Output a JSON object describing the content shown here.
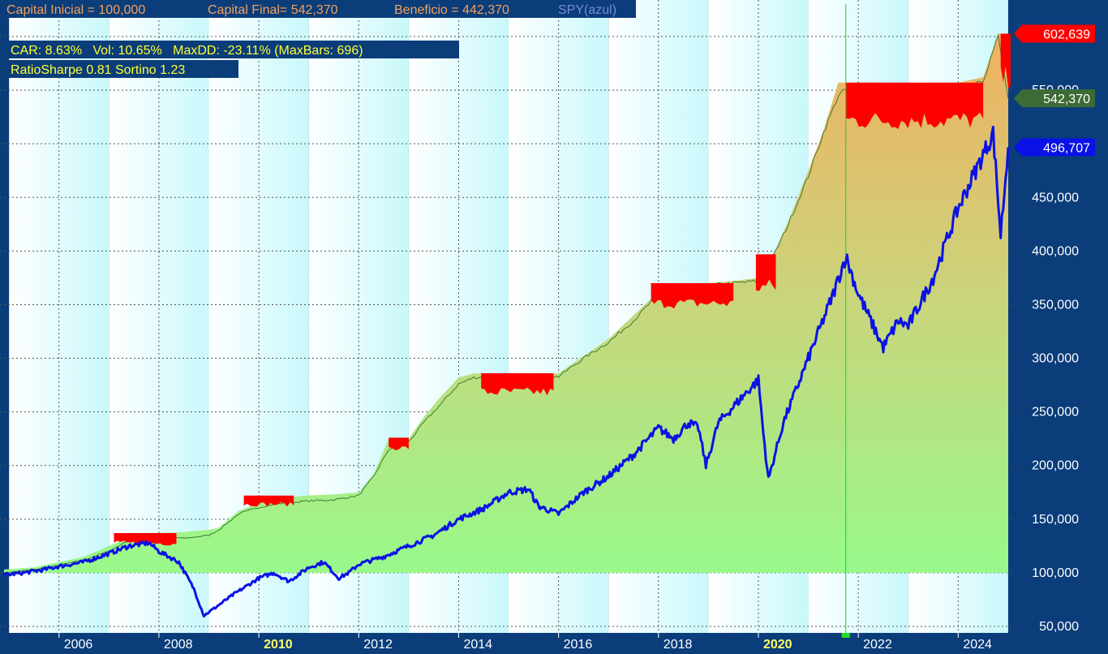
{
  "header": {
    "capital_inicial": "Capital Inicial = 100,000",
    "capital_final": "Capital Final= 542,370",
    "beneficio": "Beneficio = 442,370",
    "spy_label": "SPY(azul)"
  },
  "stats": {
    "line1": "CAR: 8.63%   Vol: 10.65%   MaxDD: -23.11% (MaxBars: 696)",
    "line2": "RatioSharpe 0.81 Sortino 1.23"
  },
  "colors": {
    "background": "#0a3d7a",
    "equity_fill_low": "#98f98a",
    "equity_fill_high": "#f0b060",
    "drawdown": "#ff0000",
    "spy_line": "#0a12e6",
    "marker_line": "#22cc22"
  },
  "chart_data": {
    "type": "area",
    "y_axis": {
      "min": 50000,
      "max": 600000,
      "ticks": [
        "50,000",
        "100,000",
        "150,000",
        "200,000",
        "250,000",
        "300,000",
        "350,000",
        "400,000",
        "450,000",
        "500,000",
        "550,000",
        "600,000"
      ],
      "tick_values": [
        50000,
        100000,
        150000,
        200000,
        250000,
        300000,
        350000,
        400000,
        450000,
        500000,
        550000,
        600000
      ]
    },
    "x_axis": {
      "labels": [
        "2006",
        "2008",
        "2010",
        "2012",
        "2014",
        "2016",
        "2018",
        "2020",
        "2022",
        "2024"
      ],
      "label_years": [
        2006,
        2008,
        2010,
        2012,
        2014,
        2016,
        2018,
        2020,
        2022,
        2024
      ],
      "bold_labels": [
        "2010",
        "2020"
      ],
      "start": 2004.9,
      "end": 2025.05
    },
    "grid": true,
    "marker_year": 2021.75,
    "value_tags": [
      {
        "label": "602,639",
        "value": 602639,
        "color": "#ff0000"
      },
      {
        "label": "542,370",
        "value": 542370,
        "color": "#3d6b35"
      },
      {
        "label": "496,707",
        "value": 496707,
        "color": "#0a12e6"
      }
    ],
    "series": [
      {
        "name": "Equity",
        "x": [
          2004.9,
          2005.5,
          2006.0,
          2006.5,
          2007.0,
          2007.5,
          2008.0,
          2008.5,
          2009.0,
          2009.2,
          2009.6,
          2010.0,
          2010.2,
          2010.5,
          2011.0,
          2011.5,
          2012.0,
          2012.3,
          2012.6,
          2013.0,
          2013.3,
          2013.6,
          2014.0,
          2014.3,
          2014.6,
          2015.0,
          2015.5,
          2016.0,
          2016.5,
          2017.0,
          2017.5,
          2018.0,
          2018.5,
          2019.0,
          2019.5,
          2020.0,
          2020.3,
          2020.6,
          2021.0,
          2021.3,
          2021.6,
          2021.75,
          2022.0,
          2022.5,
          2023.0,
          2023.5,
          2024.0,
          2024.5,
          2024.8,
          2025.0
        ],
        "y": [
          100000,
          103000,
          107000,
          112000,
          120000,
          133000,
          135000,
          132000,
          135000,
          140000,
          155000,
          161000,
          163000,
          165000,
          167000,
          168000,
          172000,
          190000,
          215000,
          222000,
          240000,
          255000,
          276000,
          282000,
          283000,
          283000,
          282000,
          283000,
          300000,
          315000,
          335000,
          360000,
          365000,
          368000,
          370000,
          372000,
          395000,
          425000,
          470000,
          510000,
          545000,
          550000,
          550000,
          550000,
          552000,
          552000,
          552000,
          560000,
          600000,
          542370
        ]
      },
      {
        "name": "Equity peak",
        "x": [
          2004.9,
          2005.5,
          2006.0,
          2006.5,
          2007.0,
          2007.5,
          2008.0,
          2008.5,
          2009.0,
          2009.2,
          2009.6,
          2010.0,
          2010.2,
          2010.5,
          2011.0,
          2011.5,
          2012.0,
          2012.3,
          2012.6,
          2013.0,
          2013.3,
          2013.6,
          2014.0,
          2014.3,
          2014.6,
          2015.0,
          2015.5,
          2016.0,
          2016.5,
          2017.0,
          2017.5,
          2018.0,
          2018.5,
          2019.0,
          2019.5,
          2020.0,
          2020.3,
          2020.6,
          2021.0,
          2021.3,
          2021.6,
          2021.75,
          2022.0,
          2022.5,
          2023.0,
          2023.5,
          2024.0,
          2024.5,
          2024.8,
          2025.0
        ],
        "y": [
          103000,
          105000,
          110000,
          115000,
          125000,
          135000,
          137000,
          138000,
          140000,
          142000,
          158000,
          165000,
          168000,
          170000,
          172000,
          173000,
          175000,
          192000,
          225000,
          225000,
          245000,
          262000,
          282000,
          286000,
          286000,
          286000,
          286000,
          286000,
          302000,
          318000,
          340000,
          362000,
          370000,
          370000,
          372000,
          375000,
          397000,
          428000,
          475000,
          512000,
          557000,
          557000,
          557000,
          557000,
          557000,
          557000,
          557000,
          562000,
          602639,
          602639
        ]
      },
      {
        "name": "SPY",
        "x": [
          2004.9,
          2005.3,
          2005.7,
          2006.0,
          2006.5,
          2007.0,
          2007.4,
          2007.8,
          2008.0,
          2008.4,
          2008.7,
          2008.9,
          2009.2,
          2009.5,
          2010.0,
          2010.3,
          2010.6,
          2011.0,
          2011.3,
          2011.6,
          2011.8,
          2012.0,
          2012.5,
          2013.0,
          2013.5,
          2014.0,
          2014.5,
          2015.0,
          2015.4,
          2015.6,
          2016.0,
          2016.5,
          2017.0,
          2017.5,
          2018.0,
          2018.3,
          2018.6,
          2018.8,
          2018.95,
          2019.2,
          2019.5,
          2020.0,
          2020.1,
          2020.2,
          2020.5,
          2021.0,
          2021.5,
          2021.75,
          2022.0,
          2022.5,
          2022.8,
          2023.0,
          2023.5,
          2024.0,
          2024.5,
          2024.7,
          2024.85,
          2025.0
        ],
        "y": [
          98000,
          100000,
          103000,
          106000,
          110000,
          118000,
          125000,
          128000,
          120000,
          110000,
          85000,
          60000,
          70000,
          80000,
          95000,
          100000,
          92000,
          105000,
          110000,
          95000,
          100000,
          108000,
          115000,
          125000,
          135000,
          150000,
          160000,
          175000,
          178000,
          162000,
          155000,
          175000,
          190000,
          210000,
          235000,
          225000,
          240000,
          235000,
          200000,
          240000,
          255000,
          280000,
          230000,
          187000,
          240000,
          300000,
          360000,
          395000,
          360000,
          310000,
          335000,
          330000,
          375000,
          440000,
          490000,
          510000,
          415000,
          496707
        ]
      }
    ],
    "drawdowns": [
      {
        "x0": 2007.1,
        "x1": 2008.35,
        "top": 137000,
        "bottom": 123000
      },
      {
        "x0": 2009.7,
        "x1": 2010.7,
        "top": 172000,
        "bottom": 160000
      },
      {
        "x0": 2012.6,
        "x1": 2013.0,
        "top": 226000,
        "bottom": 212000
      },
      {
        "x0": 2014.45,
        "x1": 2015.9,
        "top": 286000,
        "bottom": 260000
      },
      {
        "x0": 2017.85,
        "x1": 2019.5,
        "top": 370000,
        "bottom": 342000
      },
      {
        "x0": 2019.95,
        "x1": 2020.35,
        "top": 397000,
        "bottom": 352000
      },
      {
        "x0": 2021.75,
        "x1": 2024.5,
        "top": 557000,
        "bottom": 505000
      },
      {
        "x0": 2024.85,
        "x1": 2025.05,
        "top": 602639,
        "bottom": 542370
      }
    ]
  }
}
